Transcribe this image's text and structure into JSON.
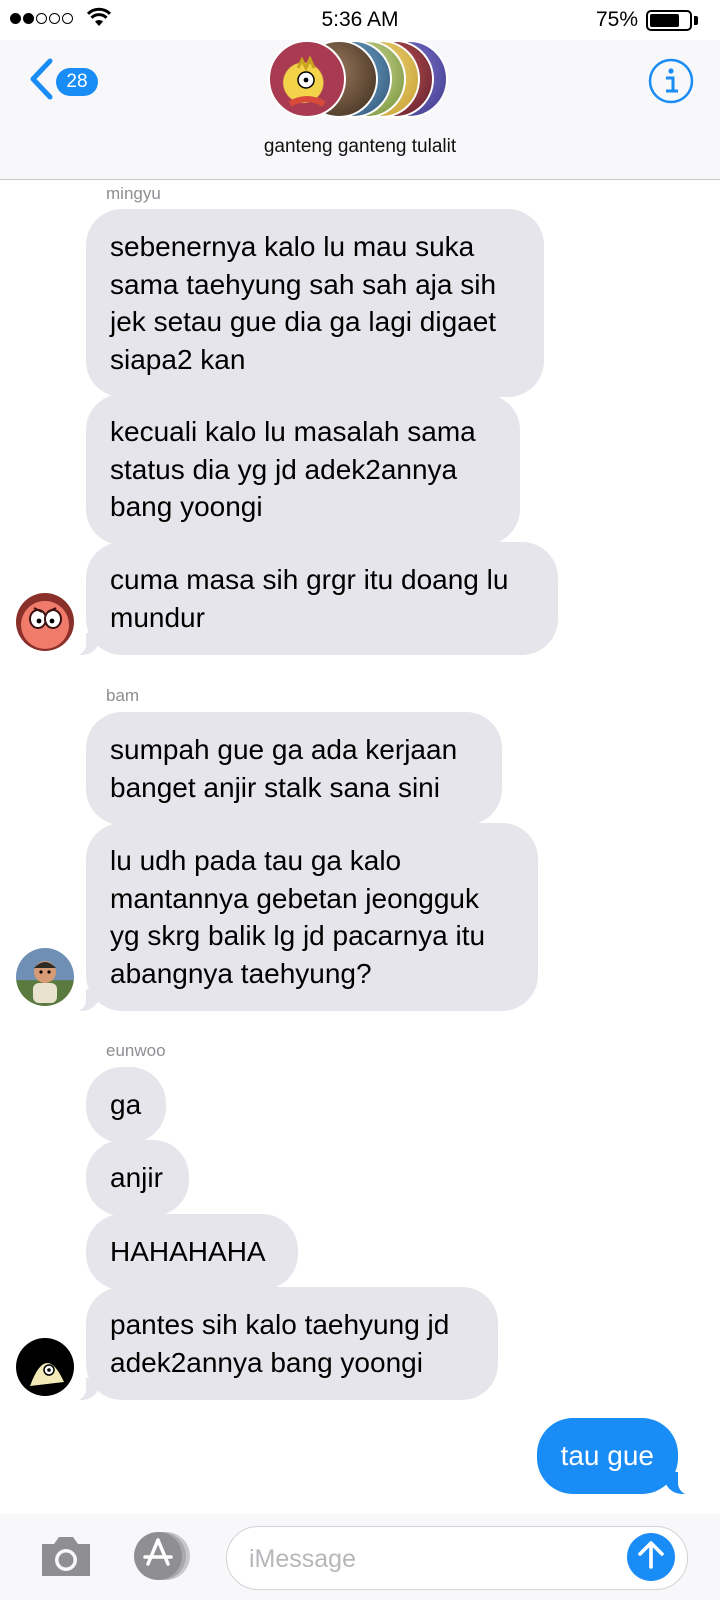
{
  "status_bar": {
    "signal_dots_filled": 2,
    "signal_dots_total": 5,
    "time": "5:36 AM",
    "battery_percent_text": "75%",
    "battery_level": 0.75
  },
  "header": {
    "back_badge": "28",
    "group_name": "ganteng ganteng tulalit",
    "accent_color": "#1a8cf5"
  },
  "messages": {
    "groups": [
      {
        "sender": "mingyu",
        "bubbles": [
          "sebenernya kalo lu mau suka sama taehyung sah sah aja sih jek setau gue dia ga lagi digaet siapa2 kan",
          "kecuali kalo lu masalah sama status dia yg jd adek2annya bang yoongi",
          "cuma masa sih grgr itu doang lu mundur"
        ]
      },
      {
        "sender": "bam",
        "bubbles": [
          "sumpah gue ga ada kerjaan banget anjir stalk sana sini",
          "lu udh pada tau ga kalo mantannya gebetan jeongguk yg skrg balik lg jd pacarnya itu abangnya taehyung?"
        ]
      },
      {
        "sender": "eunwoo",
        "bubbles": [
          "ga",
          "anjir",
          "HAHAHAHA",
          "pantes sih kalo taehyung jd adek2annya bang yoongi"
        ]
      }
    ],
    "outgoing": "tau gue"
  },
  "input_bar": {
    "placeholder": "iMessage"
  },
  "icons": {
    "back": "chevron-left-icon",
    "info": "info-icon",
    "camera": "camera-icon",
    "apps": "app-store-icon",
    "send": "arrow-up-icon",
    "wifi": "wifi-icon"
  },
  "colors": {
    "incoming_bubble": "#e6e5eb",
    "outgoing_bubble": "#1a8cf5",
    "sender_label": "#8e8e93"
  }
}
